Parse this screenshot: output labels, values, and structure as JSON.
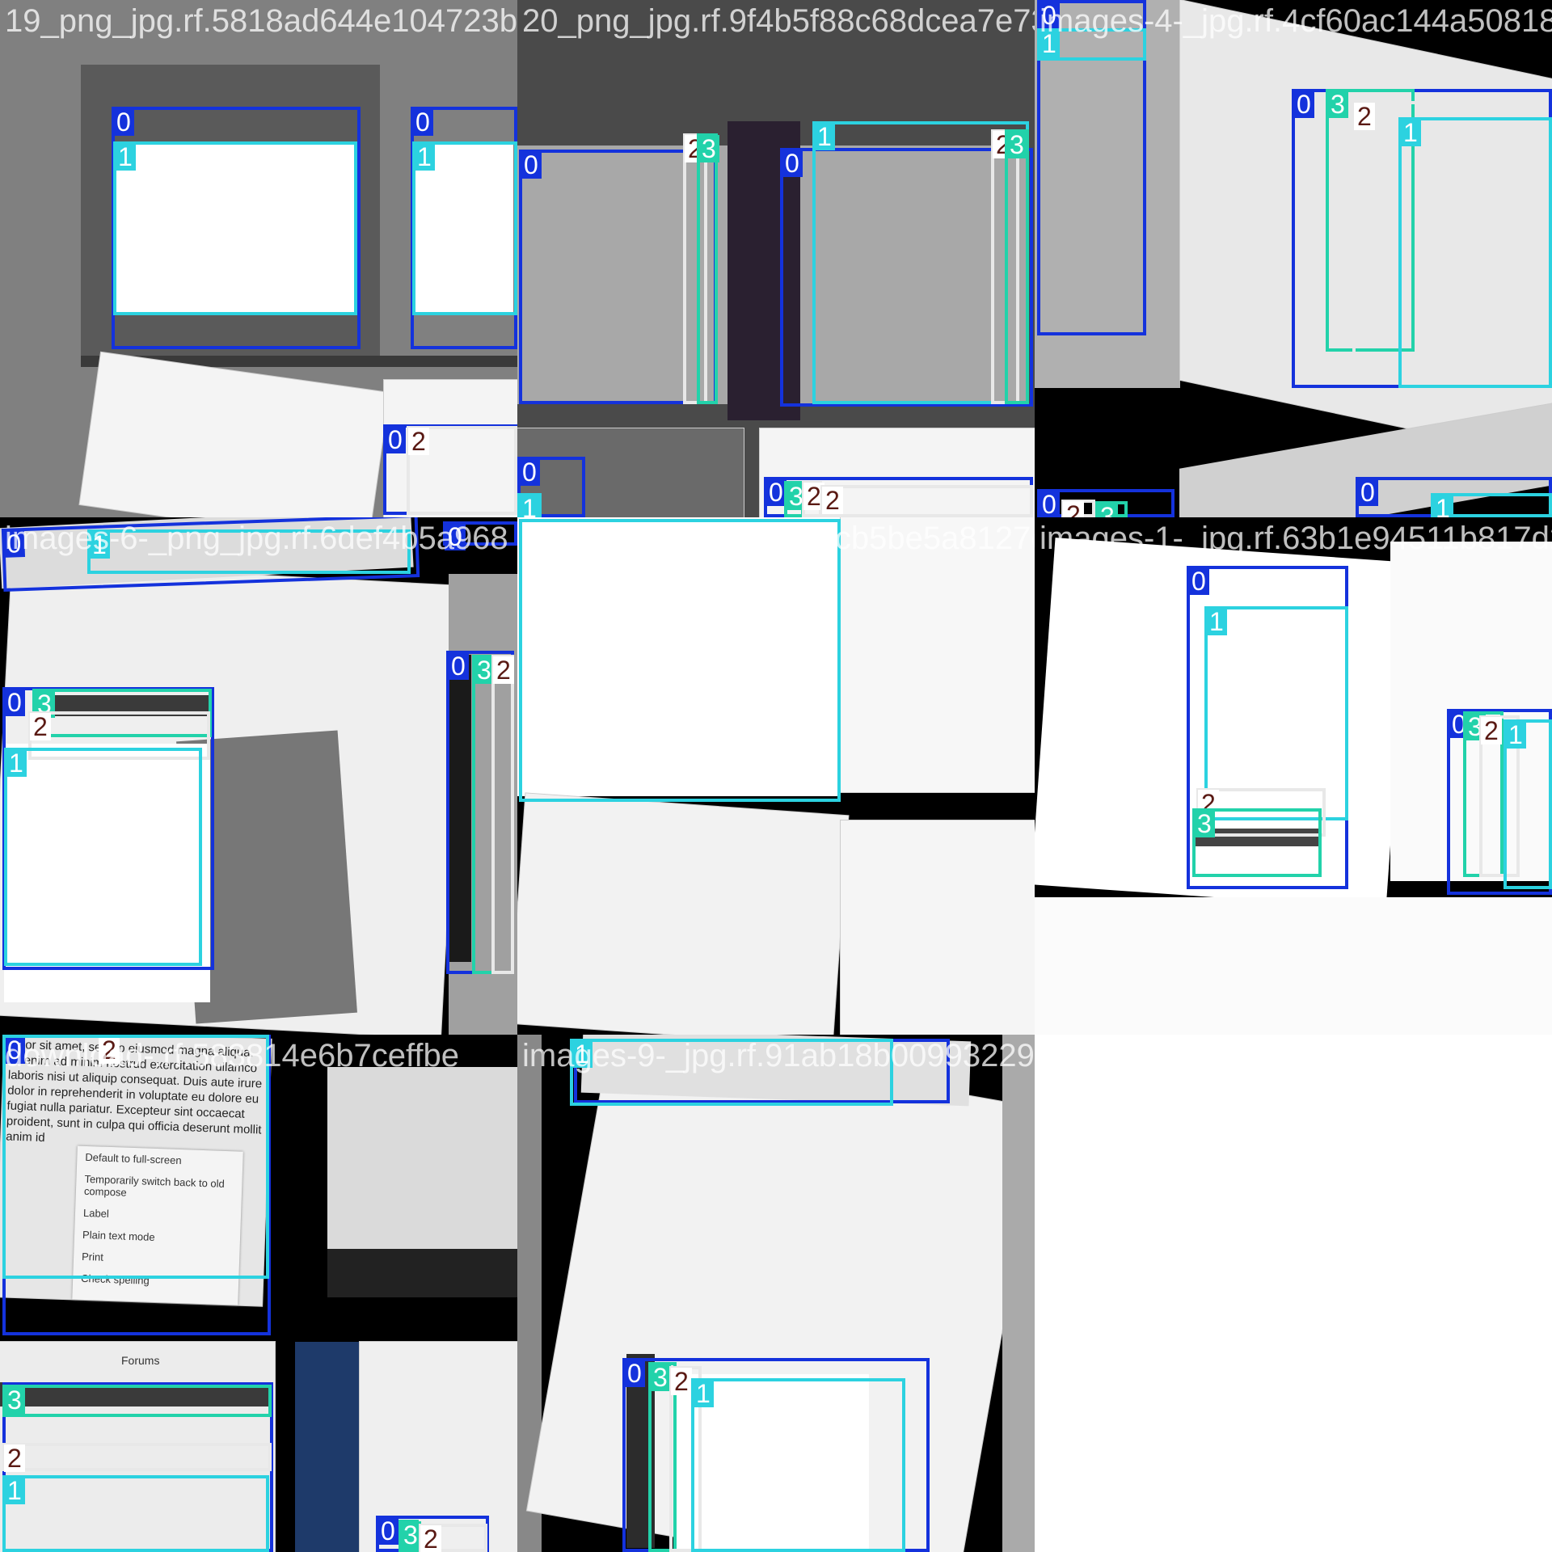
{
  "grid": {
    "tiles": [
      {
        "id": "t1",
        "filename": "19_png_jpg.rf.5818ad644e104723b4b"
      },
      {
        "id": "t2",
        "filename": "20_png_jpg.rf.9f4b5f88c68dcea7e738"
      },
      {
        "id": "t3",
        "filename": "images-4-_jpg.rf.4cf60ac144a508180"
      },
      {
        "id": "t4",
        "filename": "images-6-_png_jpg.rf.6def4b5a968"
      },
      {
        "id": "t5",
        "filename": "download-1-_jpg.rf.3bcb5be5a8127e"
      },
      {
        "id": "t6",
        "filename": "images-1-_jpg.rf.63b1e94511b817d23"
      },
      {
        "id": "t7",
        "filename": "download-.rf.583814e6b7ceffbe"
      },
      {
        "id": "t8",
        "filename": "images-9-_jpg.rf.91ab18b0099322920887d845"
      }
    ]
  },
  "classes": [
    "0",
    "1",
    "2",
    "3"
  ],
  "colors": {
    "class0": "#1432dc",
    "class1": "#2cd2e0",
    "class2": "#ffffff",
    "class3": "#22d2aa"
  },
  "dialog_text": {
    "lorem": "dolor sit amet, sed do eiusmod magna aliqua. Ut enim ad minim nostrud exercitation ullamco laboris nisi ut aliquip consequat. Duis aute irure dolor in reprehenderit in voluptate eu dolore eu fugiat nulla pariatur. Excepteur sint occaecat proident, sunt in culpa qui officia deserunt mollit anim id",
    "menu": [
      "Default to full-screen",
      "Temporarily switch back to old compose",
      "Label",
      "Plain text mode",
      "Print",
      "Check spelling"
    ],
    "forums": "Forums"
  }
}
